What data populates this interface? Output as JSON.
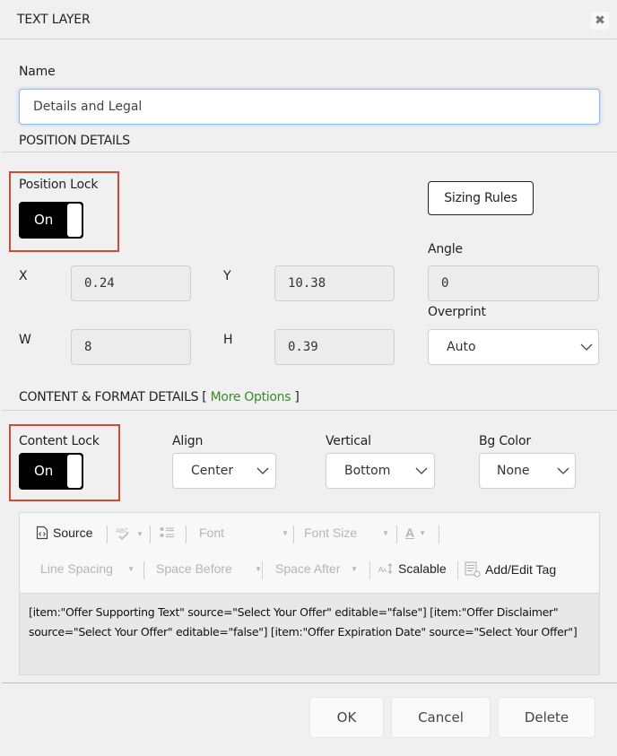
{
  "dialog": {
    "title": "TEXT LAYER",
    "close_icon": "close-icon"
  },
  "name": {
    "label": "Name",
    "value": "Details and Legal"
  },
  "position": {
    "section_title": "POSITION DETAILS",
    "lock_label": "Position Lock",
    "lock_state": "On",
    "sizing_rules_label": "Sizing Rules",
    "x_label": "X",
    "x_value": "0.24",
    "y_label": "Y",
    "y_value": "10.38",
    "w_label": "W",
    "w_value": "8",
    "h_label": "H",
    "h_value": "0.39",
    "angle_label": "Angle",
    "angle_value": "0",
    "overprint_label": "Overprint",
    "overprint_value": "Auto"
  },
  "content": {
    "section_title": "CONTENT & FORMAT DETAILS [",
    "more_options_label": "More Options",
    "section_title_end": "]",
    "lock_label": "Content Lock",
    "lock_state": "On",
    "align_label": "Align",
    "align_value": "Center",
    "vertical_label": "Vertical",
    "vertical_value": "Bottom",
    "bg_label": "Bg Color",
    "bg_value": "None"
  },
  "toolbar": {
    "source_label": "Source",
    "font_label": "Font",
    "font_size_label": "Font Size",
    "text_color_glyph": "A",
    "line_spacing_label": "Line Spacing",
    "space_before_label": "Space Before",
    "space_after_label": "Space After",
    "scalable_label": "Scalable",
    "add_edit_tag_label": "Add/Edit Tag"
  },
  "editor": {
    "text": "[item:\"Offer Supporting Text\" source=\"Select Your Offer\" editable=\"false\"] [item:\"Offer Disclaimer\" source=\"Select Your Offer\" editable=\"false\"] [item:\"Offer Expiration Date\" source=\"Select Your Offer\"]"
  },
  "footer": {
    "ok_label": "OK",
    "cancel_label": "Cancel",
    "delete_label": "Delete"
  },
  "colors": {
    "highlight_box": "#d24a33",
    "link": "#3a8a2a",
    "toggle_on": "#000000"
  }
}
